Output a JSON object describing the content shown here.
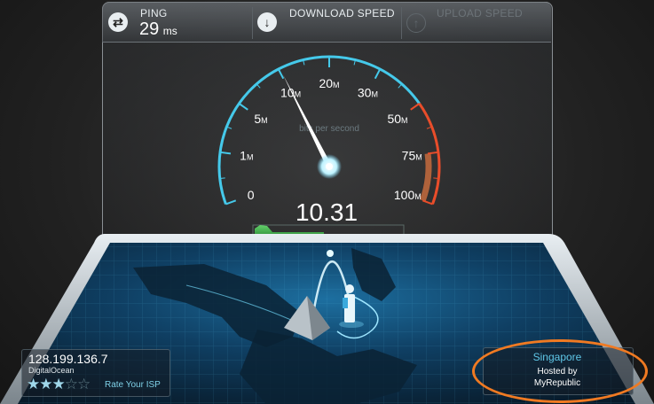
{
  "header": {
    "ping": {
      "label": "PING",
      "value": "29",
      "unit": "ms"
    },
    "download": {
      "label": "DOWNLOAD SPEED"
    },
    "upload": {
      "label": "UPLOAD SPEED"
    }
  },
  "gauge": {
    "caption": "bits per second",
    "readout": "10.31",
    "ticks": [
      {
        "label": "0",
        "unit": ""
      },
      {
        "label": "1",
        "unit": "M"
      },
      {
        "label": "5",
        "unit": "M"
      },
      {
        "label": "10",
        "unit": "M"
      },
      {
        "label": "20",
        "unit": "M"
      },
      {
        "label": "30",
        "unit": "M"
      },
      {
        "label": "50",
        "unit": "M"
      },
      {
        "label": "75",
        "unit": "M"
      },
      {
        "label": "100",
        "unit": "M"
      }
    ],
    "needle_value_mbps": 10.31
  },
  "isp": {
    "ip": "128.199.136.7",
    "name": "DigitalOcean",
    "rating": 3,
    "max_rating": 5,
    "rate_label": "Rate Your ISP"
  },
  "server": {
    "city": "Singapore",
    "hosted_line1": "Hosted by",
    "hosted_line2": "MyRepublic"
  },
  "colors": {
    "accent_cyan": "#45c9ea",
    "danger_red": "#e94d2a",
    "highlight_orange": "#f07a22"
  }
}
